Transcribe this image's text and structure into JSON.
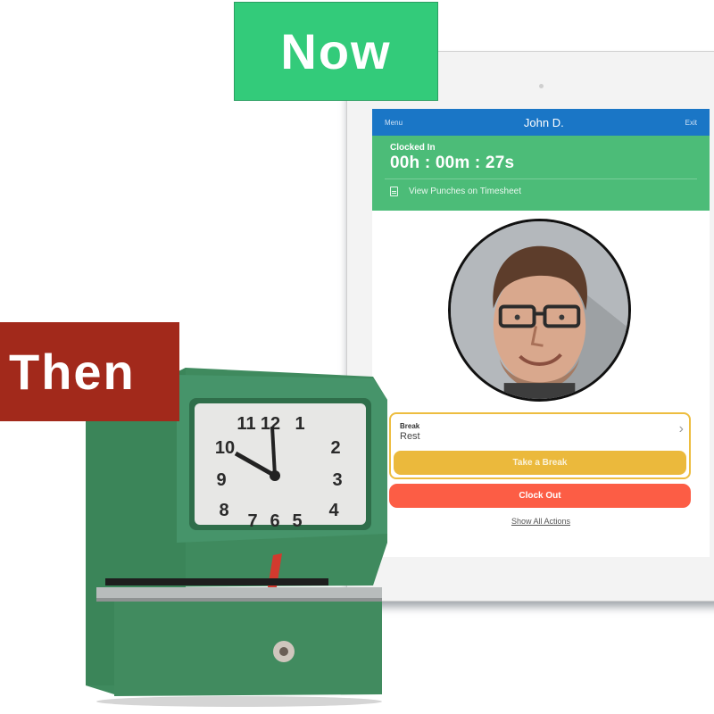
{
  "badges": {
    "now_label": "Now",
    "then_label": "Then",
    "now_color": "#33cb7a",
    "then_color": "#a2291b"
  },
  "app": {
    "header": {
      "menu_label": "Menu",
      "user_name": "John D.",
      "exit_label": "Exit"
    },
    "status": {
      "state_label": "Clocked In",
      "timer": "00h : 00m : 27s",
      "timesheet_link": "View Punches on Timesheet",
      "timesheet_icon": "document-icon"
    },
    "avatar_alt": "employee-photo",
    "break": {
      "label": "Break",
      "value": "Rest",
      "chevron": "›",
      "button_label": "Take a Break"
    },
    "clock_out_label": "Clock Out",
    "show_all_label": "Show All Actions",
    "colors": {
      "header": "#1a76c6",
      "status": "#4cbc78",
      "break": "#ebb93c",
      "clock_out": "#fc5d45"
    }
  },
  "punch_clock": {
    "dial_numbers": [
      "12",
      "1",
      "2",
      "3",
      "4",
      "5",
      "6",
      "7",
      "8",
      "9",
      "10",
      "11"
    ]
  }
}
